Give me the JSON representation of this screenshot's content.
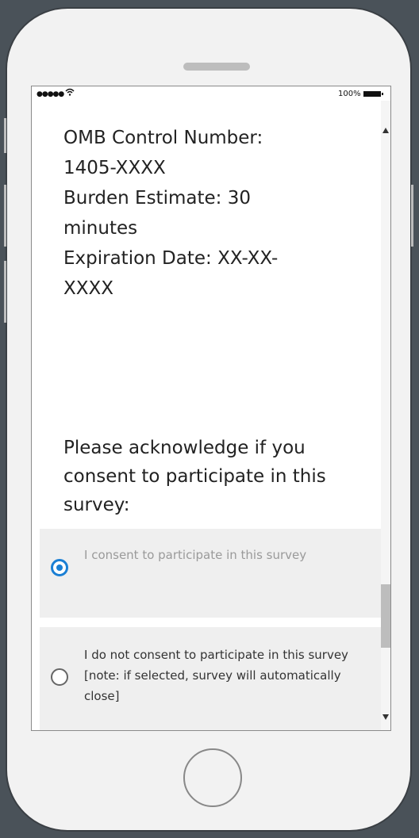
{
  "status_bar": {
    "signal": "●●●●●",
    "wifi_icon": "wifi-icon",
    "battery_text": "100%"
  },
  "omb": {
    "lines": [
      "OMB Control Number:",
      "1405-XXXX",
      "Burden Estimate:  30",
      "minutes",
      "Expiration Date: XX-XX-",
      "XXXX"
    ]
  },
  "question": {
    "text": "Please acknowledge if you consent to participate in this survey:"
  },
  "options": [
    {
      "label": "I consent to participate in this survey",
      "selected": true
    },
    {
      "label": "I do not consent to participate in this survey [note: if selected, survey will automatically close]",
      "selected": false
    }
  ],
  "colors": {
    "accent": "#1a7fd4",
    "option_bg": "#efefef",
    "frame": "#4a5259"
  }
}
